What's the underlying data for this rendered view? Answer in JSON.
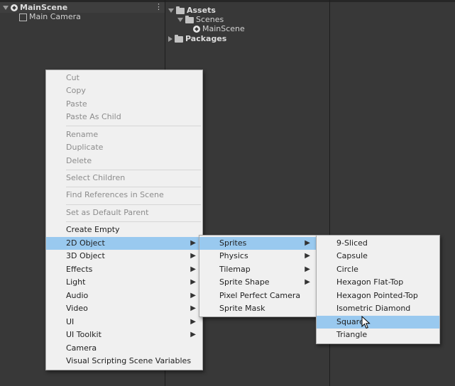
{
  "hierarchy": {
    "scene_name": "MainScene",
    "items": [
      {
        "label": "Main Camera"
      }
    ]
  },
  "project": {
    "assets_label": "Assets",
    "scenes_label": "Scenes",
    "mainscene_label": "MainScene",
    "packages_label": "Packages"
  },
  "context_menu": {
    "cut": "Cut",
    "copy": "Copy",
    "paste": "Paste",
    "paste_as_child": "Paste As Child",
    "rename": "Rename",
    "duplicate": "Duplicate",
    "delete": "Delete",
    "select_children": "Select Children",
    "find_references": "Find References in Scene",
    "set_default_parent": "Set as Default Parent",
    "create_empty": "Create Empty",
    "obj_2d": "2D Object",
    "obj_3d": "3D Object",
    "effects": "Effects",
    "light": "Light",
    "audio": "Audio",
    "video": "Video",
    "ui": "UI",
    "ui_toolkit": "UI Toolkit",
    "camera": "Camera",
    "visual_scripting": "Visual Scripting Scene Variables"
  },
  "submenu_2d": {
    "sprites": "Sprites",
    "physics": "Physics",
    "tilemap": "Tilemap",
    "sprite_shape": "Sprite Shape",
    "pixel_perfect_camera": "Pixel Perfect Camera",
    "sprite_mask": "Sprite Mask"
  },
  "submenu_sprites": {
    "nine_sliced": "9-Sliced",
    "capsule": "Capsule",
    "circle": "Circle",
    "hexagon_flat_top": "Hexagon Flat-Top",
    "hexagon_pointed_top": "Hexagon Pointed-Top",
    "isometric_diamond": "Isometric Diamond",
    "square": "Square",
    "triangle": "Triangle"
  },
  "icons": {
    "arrow": "▶",
    "kebab": "⋮"
  }
}
